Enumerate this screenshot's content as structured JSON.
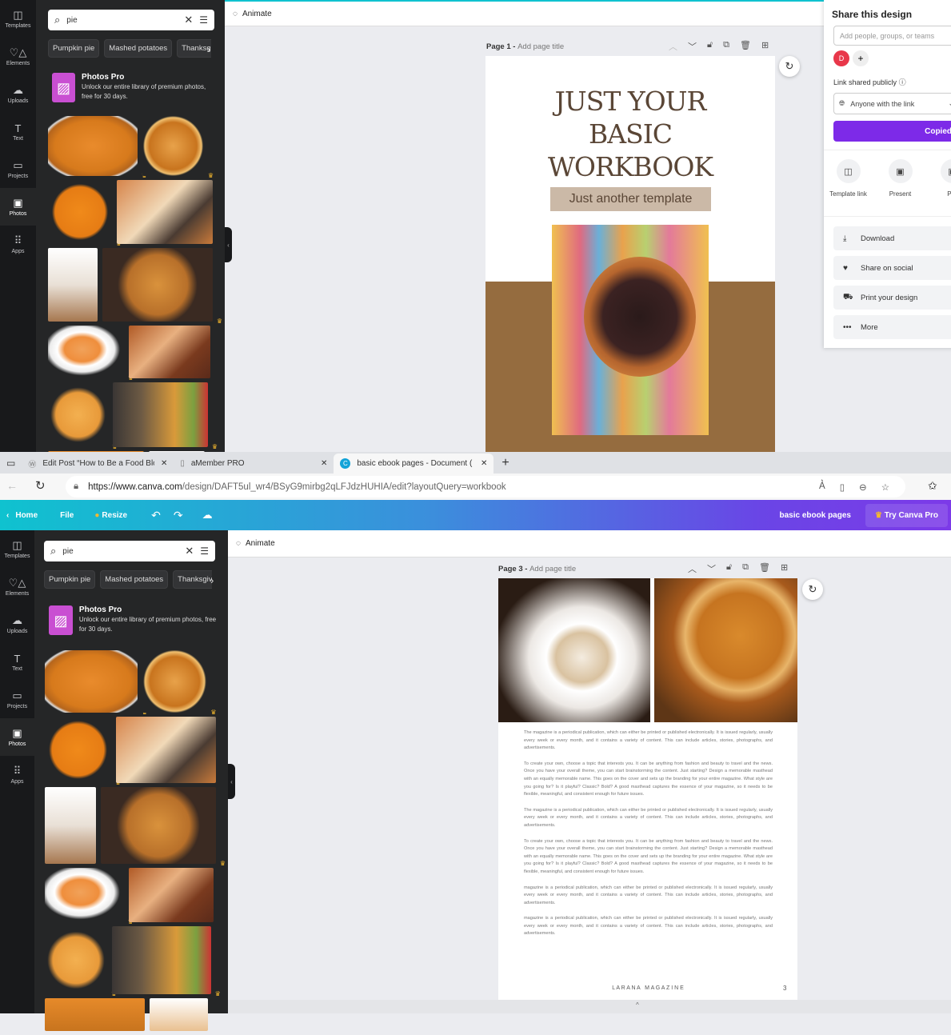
{
  "sidebar": {
    "rail": [
      {
        "label": "Templates",
        "icon": "templates-icon",
        "glyph": "◫"
      },
      {
        "label": "Elements",
        "icon": "elements-icon",
        "glyph": "♡△"
      },
      {
        "label": "Uploads",
        "icon": "upload-cloud-icon",
        "glyph": "☁"
      },
      {
        "label": "Text",
        "icon": "text-icon",
        "glyph": "T"
      },
      {
        "label": "Projects",
        "icon": "folder-icon",
        "glyph": "▭"
      },
      {
        "label": "Photos",
        "icon": "photos-icon",
        "glyph": "▣",
        "active": true
      },
      {
        "label": "Apps",
        "icon": "apps-icon",
        "glyph": "⠿"
      }
    ],
    "search_value": "pie",
    "chips": [
      "Pumpkin pie",
      "Mashed potatoes",
      "Thanksgiving"
    ],
    "promo": {
      "title": "Photos Pro",
      "text": "Unlock our entire library of premium photos, free for 30 days."
    }
  },
  "top": {
    "animate": "Animate",
    "page_label": "Page 1 -",
    "page_title_placeholder": "Add page title",
    "cover": {
      "title_lines": [
        "JUST YOUR",
        "BASIC",
        "WORKBOOK"
      ],
      "subtitle": "Just another template"
    },
    "colors": {
      "cover_brown": "#956c3f",
      "subtitle_bg": "#cbb9a7",
      "title": "#5a4636"
    }
  },
  "share": {
    "title": "Share this design",
    "input_placeholder": "Add people, groups, or teams",
    "avatar": "D",
    "add": "+",
    "link_label": "Link shared publicly",
    "access": "Anyone with the link",
    "copy_button": "Copied",
    "quick": [
      {
        "label": "Template link",
        "icon": "template-link-icon"
      },
      {
        "label": "Present",
        "icon": "present-icon"
      },
      {
        "label": "Pre",
        "icon": "present-record-icon"
      }
    ],
    "actions": [
      {
        "label": "Download",
        "icon": "download-icon",
        "glyph": "⤓"
      },
      {
        "label": "Share on social",
        "icon": "social-heart-icon",
        "glyph": "♥"
      },
      {
        "label": "Print your design",
        "icon": "print-truck-icon",
        "glyph": "⛟"
      },
      {
        "label": "More",
        "icon": "more-icon",
        "glyph": "•••"
      }
    ],
    "accent": "#7d2ae8"
  },
  "browser": {
    "tabs": [
      {
        "title": "Edit Post “How to Be a Food Blog",
        "icon": "wordpress-icon"
      },
      {
        "title": "aMember PRO",
        "icon": "document-icon"
      },
      {
        "title": "basic ebook pages - Document (",
        "icon": "canva-icon",
        "active": true
      }
    ],
    "url_host": "https://www.canva.com",
    "url_path": "/design/DAFT5ul_wr4/BSyG9mirbg2qLFJdzHUHIA/edit?layoutQuery=workbook"
  },
  "canva_header": {
    "home": "Home",
    "file": "File",
    "resize": "Resize",
    "doc_title": "basic ebook pages",
    "try_pro": "Try Canva Pro"
  },
  "bottom": {
    "animate": "Animate",
    "page_label": "Page 3 -",
    "page_title_placeholder": "Add page title",
    "paragraphs": [
      "The magazine is a periodical publication, which can either be printed or published electronically. It is issued regularly, usually every week or every month, and it contains a variety of content. This can include articles, stories, photographs, and advertisements.",
      "To create your own, choose a topic that interests you. It can be anything from fashion and beauty to travel and the news. Once you have your overall theme, you can start brainstorming the content. Just starting? Design a memorable masthead with an equally memorable name. This goes on the cover and sets up the branding for your entire magazine. What style are you going for? Is it playful? Classic? Bold? A good masthead captures the essence of your magazine, so it needs to be flexible, meaningful, and consistent enough for future issues.",
      "The magazine is a periodical publication, which can either be printed or published electronically. It is issued regularly, usually every week or every month, and it contains a variety of content. This can include articles, stories, photographs, and advertisements.",
      "To create your own, choose a topic that interests you. It can be anything from fashion and beauty to travel and the news. Once you have your overall theme, you can start brainstorming the content. Just starting? Design a memorable masthead with an equally memorable name. This goes on the cover and sets up the branding for your entire magazine. What style are you going for? Is it playful? Classic? Bold? A good masthead captures the essence of your magazine, so it needs to be flexible, meaningful, and consistent enough for future issues.",
      " magazine is a periodical publication, which can either be printed or published electronically. It is issued regularly, usually every week or every month, and it contains a variety of content. This can include articles, stories, photographs, and advertisements.",
      " magazine is a periodical publication, which can either be printed or published electronically. It is issued regularly, usually every week or every month, and it contains a variety of content. This can include articles, stories, photographs, and advertisements."
    ],
    "footer": "L A R A N A   M A G A Z I N E",
    "page_number": "3"
  }
}
